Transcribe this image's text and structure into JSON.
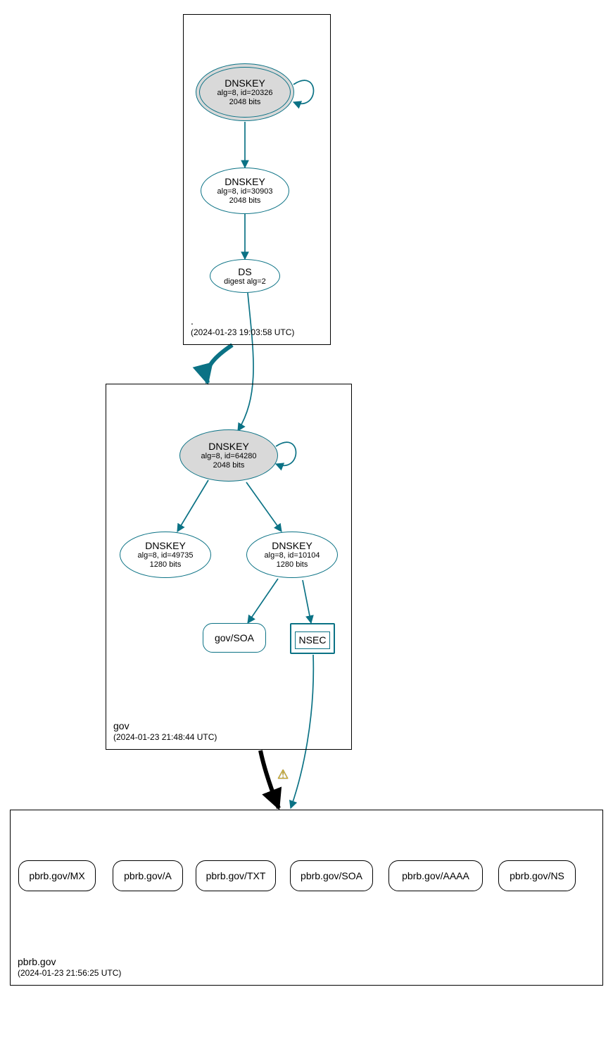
{
  "colors": {
    "teal": "#0b7285",
    "black": "#000000",
    "node_fill_grey": "#d9d9d9"
  },
  "zones": {
    "root": {
      "name": ".",
      "timestamp": "(2024-01-23 19:03:58 UTC)"
    },
    "gov": {
      "name": "gov",
      "timestamp": "(2024-01-23 21:48:44 UTC)"
    },
    "pbrb": {
      "name": "pbrb.gov",
      "timestamp": "(2024-01-23 21:56:25 UTC)"
    }
  },
  "nodes": {
    "root_ksk": {
      "title": "DNSKEY",
      "line2": "alg=8, id=20326",
      "line3": "2048 bits"
    },
    "root_zsk": {
      "title": "DNSKEY",
      "line2": "alg=8, id=30903",
      "line3": "2048 bits"
    },
    "root_ds": {
      "title": "DS",
      "line2": "digest alg=2"
    },
    "gov_ksk": {
      "title": "DNSKEY",
      "line2": "alg=8, id=64280",
      "line3": "2048 bits"
    },
    "gov_zsk1": {
      "title": "DNSKEY",
      "line2": "alg=8, id=49735",
      "line3": "1280 bits"
    },
    "gov_zsk2": {
      "title": "DNSKEY",
      "line2": "alg=8, id=10104",
      "line3": "1280 bits"
    },
    "gov_soa": {
      "title": "gov/SOA"
    },
    "nsec": {
      "title": "NSEC"
    },
    "pbrb_mx": {
      "title": "pbrb.gov/MX"
    },
    "pbrb_a": {
      "title": "pbrb.gov/A"
    },
    "pbrb_txt": {
      "title": "pbrb.gov/TXT"
    },
    "pbrb_soa": {
      "title": "pbrb.gov/SOA"
    },
    "pbrb_aaaa": {
      "title": "pbrb.gov/AAAA"
    },
    "pbrb_ns": {
      "title": "pbrb.gov/NS"
    }
  },
  "warning_icon": "⚠"
}
